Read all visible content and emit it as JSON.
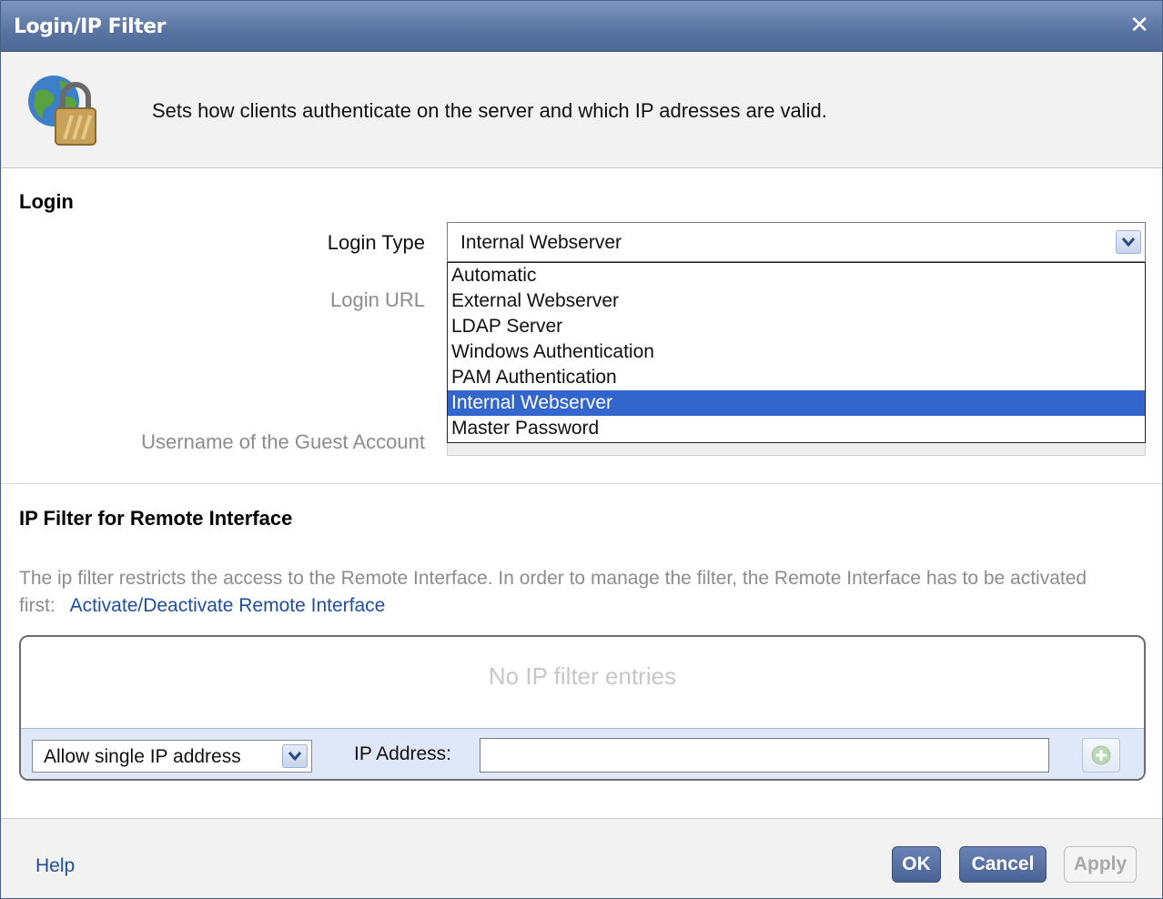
{
  "window": {
    "title": "Login/IP Filter",
    "close_symbol": "✕"
  },
  "header": {
    "description": "Sets how clients authenticate on the server and which IP adresses are valid.",
    "icon": "globe-lock-icon"
  },
  "login": {
    "section_title": "Login",
    "login_type_label": "Login Type",
    "login_type_value": "Internal Webserver",
    "login_url_label": "Login URL",
    "guest_label": "Username of the Guest Account",
    "dropdown_options": [
      "Automatic",
      "External Webserver",
      "LDAP Server",
      "Windows Authentication",
      "PAM Authentication",
      "Internal Webserver",
      "Master Password"
    ],
    "selected_option": "Internal Webserver"
  },
  "ip_filter": {
    "section_title": "IP Filter for Remote Interface",
    "description": "The ip filter restricts the access to the Remote Interface. In order to manage the filter, the Remote Interface has to be activated first:",
    "activate_link": "Activate/Deactivate Remote Interface",
    "empty_text": "No IP filter entries",
    "mode_value": "Allow single IP address",
    "ip_label": "IP Address:",
    "ip_value": ""
  },
  "footer": {
    "help": "Help",
    "ok": "OK",
    "cancel": "Cancel",
    "apply": "Apply"
  },
  "colors": {
    "titlebar": "#5a74a2",
    "selection": "#3366cc",
    "link": "#1f4ea0"
  }
}
